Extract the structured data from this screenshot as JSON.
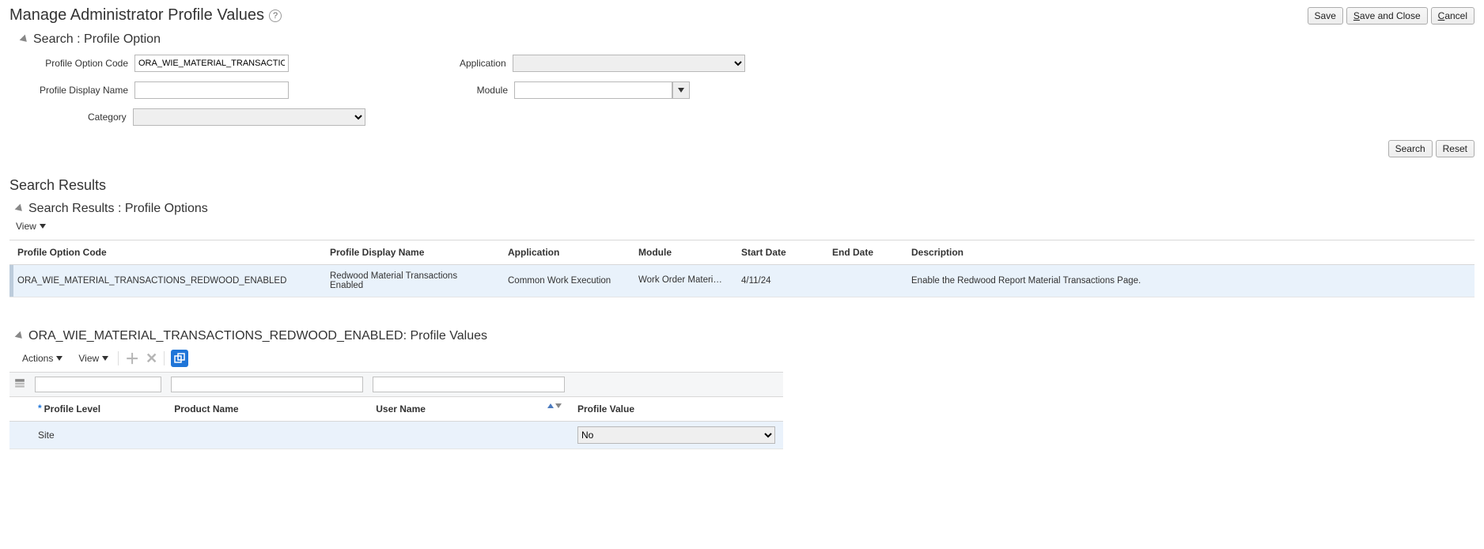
{
  "header": {
    "title": "Manage Administrator Profile Values",
    "buttons": {
      "save": "Save",
      "saveClose": "Save and Close",
      "cancel": "Cancel"
    }
  },
  "search": {
    "title": "Search : Profile Option",
    "labels": {
      "profileOptionCode": "Profile Option Code",
      "application": "Application",
      "profileDisplayName": "Profile Display Name",
      "module": "Module",
      "category": "Category"
    },
    "values": {
      "profileOptionCode": "ORA_WIE_MATERIAL_TRANSACTIONS_",
      "application": "",
      "profileDisplayName": "",
      "module": "",
      "category": ""
    },
    "buttons": {
      "search": "Search",
      "reset": "Reset"
    }
  },
  "resultsTitle": "Search Results",
  "resultsSection": {
    "title": "Search Results : Profile Options",
    "viewMenu": "View",
    "columns": [
      "Profile Option Code",
      "Profile Display Name",
      "Application",
      "Module",
      "Start Date",
      "End Date",
      "Description"
    ],
    "row": {
      "code": "ORA_WIE_MATERIAL_TRANSACTIONS_REDWOOD_ENABLED",
      "display": "Redwood Material Transactions Enabled",
      "app": "Common Work Execution",
      "module": "Work Order Material Tr…",
      "startDate": "4/11/24",
      "endDate": "",
      "desc": "Enable the Redwood Report Material Transactions Page."
    }
  },
  "valuesSection": {
    "title": "ORA_WIE_MATERIAL_TRANSACTIONS_REDWOOD_ENABLED: Profile Values",
    "actionsMenu": "Actions",
    "viewMenu": "View",
    "columns": {
      "level": "Profile Level",
      "product": "Product Name",
      "user": "User Name",
      "value": "Profile Value"
    },
    "row": {
      "level": "Site",
      "product": "",
      "user": "",
      "value": "No"
    }
  }
}
